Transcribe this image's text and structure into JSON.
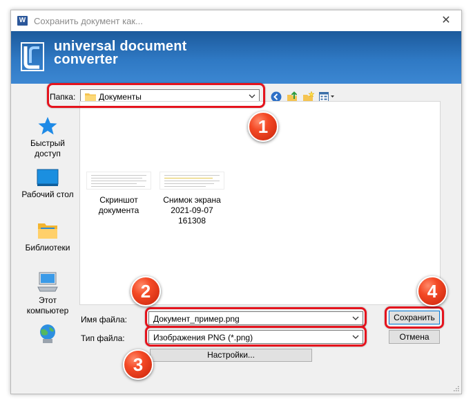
{
  "dialog": {
    "title": "Сохранить документ как...",
    "app_icon_letter": "W",
    "close_glyph": "✕"
  },
  "banner": {
    "line1": "universal document",
    "line2": "converter"
  },
  "folder": {
    "label": "Папка:",
    "value": "Документы",
    "toolbar_icons": [
      "back-icon",
      "up-folder-icon",
      "new-folder-icon",
      "view-menu-icon"
    ]
  },
  "places": [
    {
      "label_line1": "Быстрый",
      "label_line2": "доступ",
      "icon": "star-icon"
    },
    {
      "label_line1": "Рабочий стол",
      "label_line2": "",
      "icon": "desktop-icon"
    },
    {
      "label_line1": "Библиотеки",
      "label_line2": "",
      "icon": "libraries-icon"
    },
    {
      "label_line1": "Этот",
      "label_line2": "компьютер",
      "icon": "computer-icon"
    },
    {
      "label_line1": "",
      "label_line2": "",
      "icon": "network-icon"
    }
  ],
  "files": [
    {
      "name_line1": "Скриншот",
      "name_line2": "документа"
    },
    {
      "name_line1": "Снимок экрана",
      "name_line2": "2021-09-07 161308"
    }
  ],
  "filename": {
    "label": "Имя файла:",
    "value": "Документ_пример.png"
  },
  "filetype": {
    "label": "Тип файла:",
    "value": "Изображения PNG (*.png)"
  },
  "buttons": {
    "save": "Сохранить",
    "cancel": "Отмена",
    "settings": "Настройки..."
  },
  "badges": [
    "1",
    "2",
    "3",
    "4"
  ],
  "colors": {
    "highlight_red": "#e5131d",
    "badge_orange": "#f44a26",
    "banner_blue": "#2f79c4"
  }
}
